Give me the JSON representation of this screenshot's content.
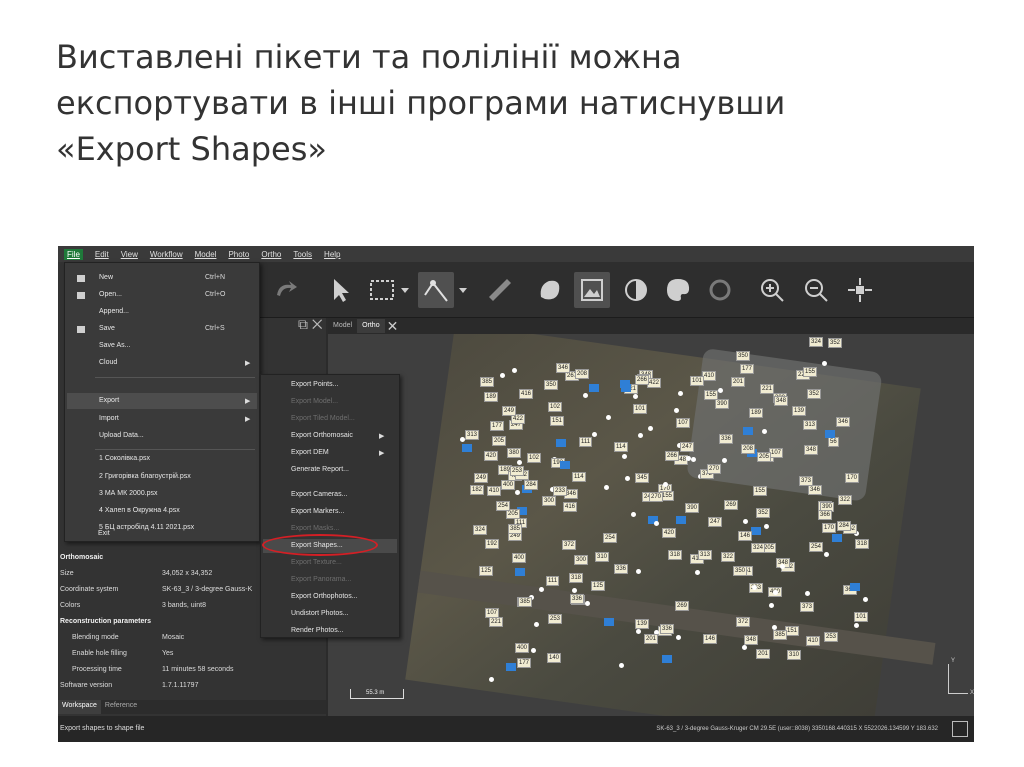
{
  "slide": {
    "title_line1": "Виставлені пікети та полілінії можна",
    "title_line2": "експортувати в інші програми натиснувши",
    "title_line3": "«Export Shapes»"
  },
  "menubar": [
    "File",
    "Edit",
    "View",
    "Workflow",
    "Model",
    "Photo",
    "Ortho",
    "Tools",
    "Help"
  ],
  "file_menu": {
    "new": "New",
    "new_sc": "Ctrl+N",
    "open": "Open...",
    "open_sc": "Ctrl+O",
    "append": "Append...",
    "save": "Save",
    "save_sc": "Ctrl+S",
    "save_as": "Save As...",
    "cloud": "Cloud",
    "export": "Export",
    "import": "Import",
    "upload": "Upload Data...",
    "recent1": "1 Соколівка.psx",
    "recent2": "2 Григорівка благоустрій.psx",
    "recent3": "3 МА МК 2000.psx",
    "recent4": "4 Халеп в Окружна 4.psx",
    "recent5": "5 БЦ астробілд 4.11 2021.psx",
    "exit": "Exit"
  },
  "export_menu": {
    "points": "Export Points...",
    "model": "Export Model...",
    "tiled": "Export Tiled Model...",
    "ortho": "Export Orthomosaic",
    "dem": "Export DEM",
    "report": "Generate Report...",
    "cameras": "Export Cameras...",
    "markers": "Export Markers...",
    "masks": "Export Masks...",
    "shapes": "Export Shapes...",
    "texture": "Export Texture...",
    "panorama": "Export Panorama...",
    "orthophotos": "Export Orthophotos...",
    "undistort": "Undistort Photos...",
    "render": "Render Photos..."
  },
  "doc_tabs": {
    "model": "Model",
    "ortho": "Ortho"
  },
  "properties": {
    "section1": "Orthomosaic",
    "size_k": "Size",
    "size_v": "34,052 x 34,352",
    "cs_k": "Coordinate system",
    "cs_v": "SK-63_3 / 3-degree Gauss-K",
    "colors_k": "Colors",
    "colors_v": "3 bands, uint8",
    "section2": "Reconstruction parameters",
    "blend_k": "Blending mode",
    "blend_v": "Mosaic",
    "hole_k": "Enable hole filling",
    "hole_v": "Yes",
    "time_k": "Processing time",
    "time_v": "11 minutes 58 seconds",
    "sw_k": "Software version",
    "sw_v": "1.7.1.11797"
  },
  "bottom_tabs": {
    "workspace": "Workspace",
    "reference": "Reference"
  },
  "hint": "Export shapes to shape file",
  "status": "SK-63_3 / 3-degree Gauss-Kruger CM 29.5E (user::8038)  3350168.440315 X  5522026.134599 Y  183.632",
  "scale_label": "55.3 m",
  "axis": {
    "x": "X",
    "y": "Y"
  },
  "pickets": [
    "420",
    "416",
    "400",
    "422",
    "410",
    "318",
    "390",
    "266",
    "322",
    "300",
    "336",
    "170",
    "348",
    "201",
    "177",
    "346",
    "208",
    "155",
    "221",
    "233",
    "56",
    "192",
    "248",
    "167",
    "253",
    "366",
    "205",
    "249",
    "114",
    "140",
    "182",
    "139",
    "262",
    "254",
    "313",
    "352",
    "372",
    "380",
    "385",
    "373",
    "348",
    "350",
    "252",
    "247",
    "101",
    "111",
    "107",
    "269",
    "324",
    "125",
    "189",
    "267",
    "345",
    "327",
    "146",
    "310",
    "270",
    "284",
    "151",
    "102"
  ]
}
